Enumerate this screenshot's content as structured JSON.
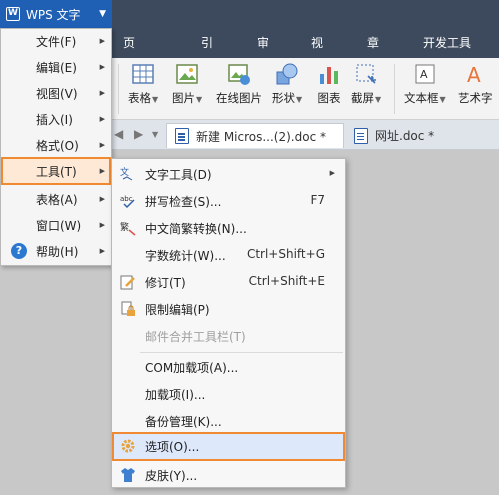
{
  "app": {
    "name": "WPS 文字"
  },
  "tabs": [
    "页面布局",
    "引用",
    "审阅",
    "视图",
    "章节",
    "开发工具"
  ],
  "ribbon": {
    "table": "表格",
    "picture": "图片",
    "online_picture": "在线图片",
    "shape": "形状",
    "chart": "图表",
    "screenshot": "截屏",
    "textbox": "文本框",
    "wordart": "艺术字"
  },
  "doc_tabs": [
    "新建 Micros...(2).doc *",
    "网址.doc *"
  ],
  "main_menu": [
    "文件(F)",
    "编辑(E)",
    "视图(V)",
    "插入(I)",
    "格式(O)",
    "工具(T)",
    "表格(A)",
    "窗口(W)",
    "帮助(H)"
  ],
  "tools_menu": {
    "text_tools": "文字工具(D)",
    "spell_check": "拼写检查(S)...",
    "spell_shortcut": "F7",
    "chinese_convert": "中文简繁转换(N)...",
    "word_count": "字数统计(W)...",
    "word_count_shortcut": "Ctrl+Shift+G",
    "revision": "修订(T)",
    "revision_shortcut": "Ctrl+Shift+E",
    "restrict_edit": "限制编辑(P)",
    "mail_merge": "邮件合并工具栏(T)",
    "com_addins": "COM加载项(A)...",
    "addins": "加载项(I)...",
    "backup": "备份管理(K)...",
    "options": "选项(O)...",
    "skin": "皮肤(Y)..."
  },
  "colors": {
    "highlight_border": "#ef8a33",
    "app_button": "#1f5fb4",
    "top_bar": "#3d4a5d"
  }
}
